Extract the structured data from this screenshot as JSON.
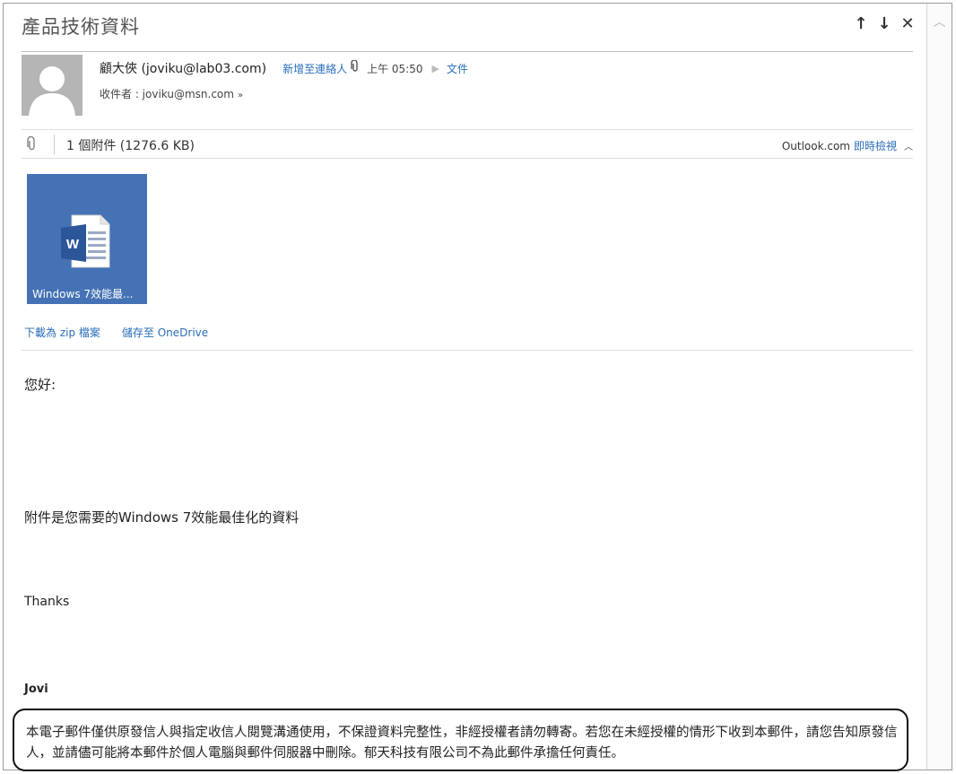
{
  "email": {
    "subject": "產品技術資料",
    "sender": "顧大俠 (joviku@lab03.com)",
    "add_contact": "新增至連絡人",
    "time": "上午 05:50",
    "category": "文件",
    "recipient": "收件者 : joviku@msn.com",
    "attachment_count": "1 個附件 (1276.6 KB)",
    "preview_brand": "Outlook.com",
    "preview_link": "即時檢視",
    "attachment_name": "Windows 7效能最...",
    "download_zip": "下載為 zip 檔案",
    "save_onedrive": "儲存至 OneDrive",
    "greeting": "您好:",
    "body_line": "附件是您需要的Windows 7效能最佳化的資料",
    "thanks": "Thanks",
    "signature": "Jovi",
    "disclaimer": "本電子郵件僅供原發信人與指定收信人閱覽溝通使用，不保證資料完整性，非經授權者請勿轉寄。若您在未經授權的情形下收到本郵件，請您告知原發信人，並請儘可能將本郵件於個人電腦與郵件伺服器中刪除。郁天科技有限公司不為此郵件承擔任何責任。"
  },
  "icons": {
    "nav": [
      "arrow-up-icon",
      "arrow-down-icon",
      "close-icon"
    ],
    "attachment": "paperclip-icon",
    "file": "word-document-icon"
  },
  "colors": {
    "link": "#2a6ebb",
    "tile": "#4472b5"
  }
}
